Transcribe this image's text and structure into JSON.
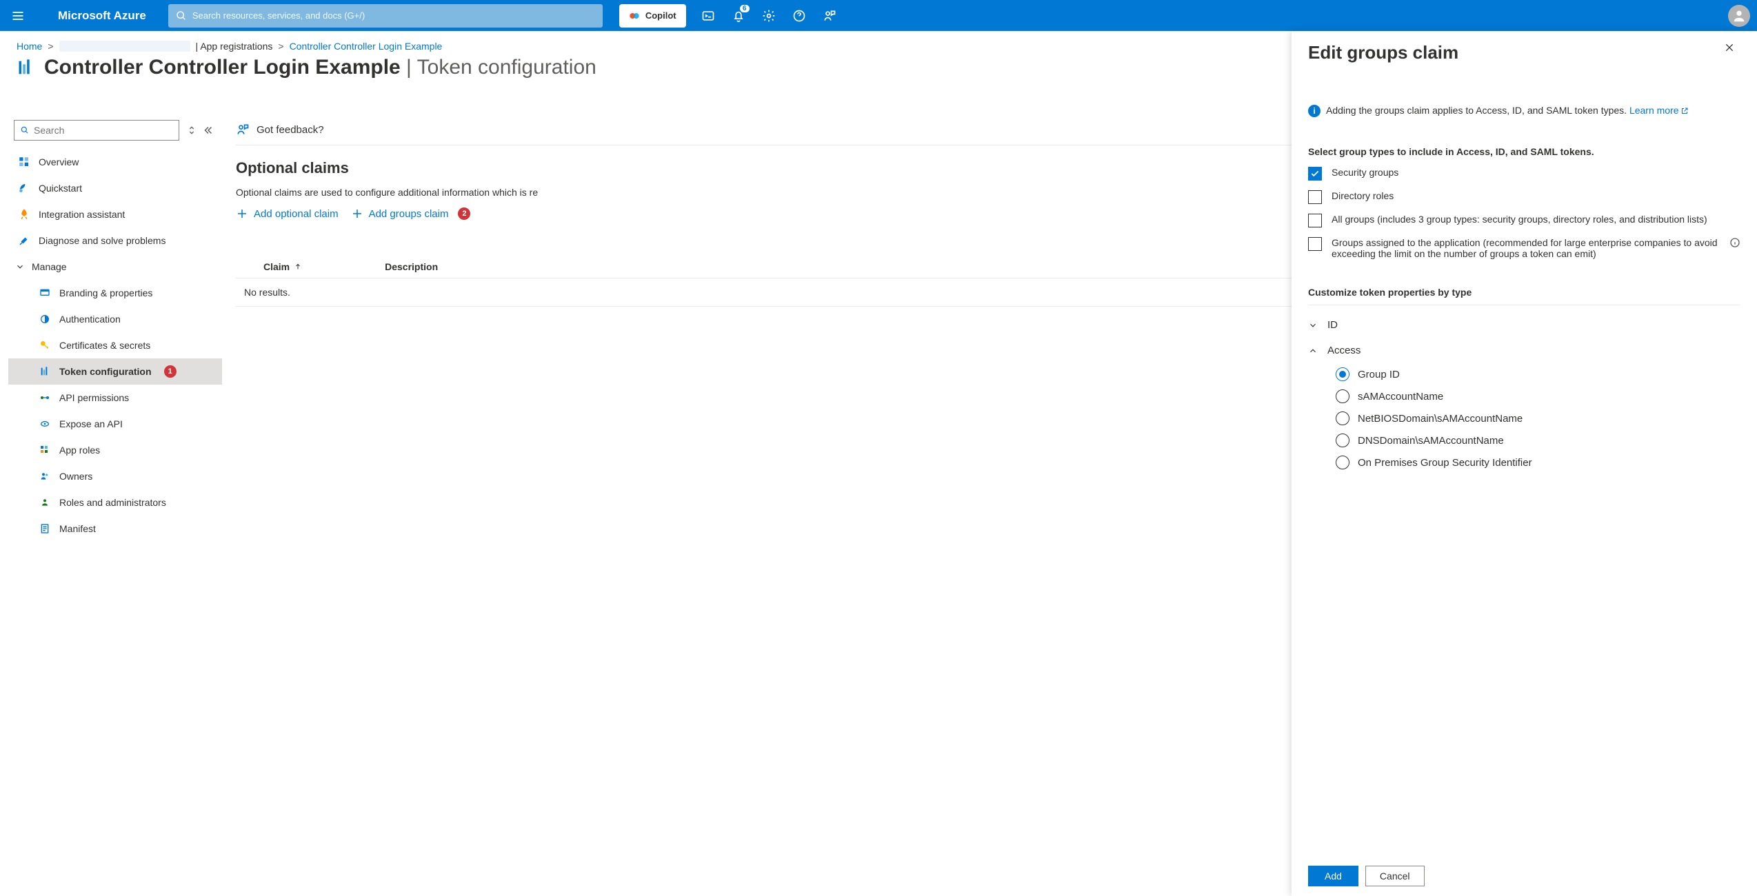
{
  "header": {
    "brand": "Microsoft Azure",
    "search_placeholder": "Search resources, services, and docs (G+/)",
    "copilot": "Copilot",
    "notification_count": "6"
  },
  "breadcrumb": {
    "home": "Home",
    "sep": ">",
    "app_reg": "App registrations",
    "current": "Controller Controller Login Example"
  },
  "page": {
    "title": "Controller Controller Login Example",
    "separator": " | ",
    "subtitle": "Token configuration"
  },
  "sidebar": {
    "search_placeholder": "Search",
    "items": {
      "overview": "Overview",
      "quickstart": "Quickstart",
      "integration": "Integration assistant",
      "diagnose": "Diagnose and solve problems"
    },
    "manage": {
      "header": "Manage",
      "branding": "Branding & properties",
      "auth": "Authentication",
      "certs": "Certificates & secrets",
      "token": "Token configuration",
      "token_badge": "1",
      "api_perm": "API permissions",
      "expose": "Expose an API",
      "approles": "App roles",
      "owners": "Owners",
      "roles": "Roles and administrators",
      "manifest": "Manifest"
    }
  },
  "workspace": {
    "feedback": "Got feedback?",
    "section_title": "Optional claims",
    "section_desc": "Optional claims are used to configure additional information which is re",
    "add_optional": "Add optional claim",
    "add_groups": "Add groups claim",
    "add_groups_badge": "2",
    "table": {
      "col_claim": "Claim",
      "col_desc": "Description",
      "empty": "No results."
    }
  },
  "flyout": {
    "title": "Edit groups claim",
    "info_text": "Adding the groups claim applies to Access, ID, and SAML token types. ",
    "learn_more": "Learn more",
    "select_heading": "Select group types to include in Access, ID, and SAML tokens.",
    "opts": {
      "security": "Security groups",
      "directory": "Directory roles",
      "all": "All groups (includes 3 group types: security groups, directory roles, and distribution lists)",
      "assigned": "Groups assigned to the application (recommended for large enterprise companies to avoid exceeding the limit on the number of groups a token can emit)"
    },
    "customize_heading": "Customize token properties by type",
    "acc": {
      "id": "ID",
      "access": "Access"
    },
    "radios": {
      "groupid": "Group ID",
      "sam": "sAMAccountName",
      "netbios": "NetBIOSDomain\\sAMAccountName",
      "dns": "DNSDomain\\sAMAccountName",
      "onprem": "On Premises Group Security Identifier"
    },
    "add": "Add",
    "cancel": "Cancel"
  }
}
